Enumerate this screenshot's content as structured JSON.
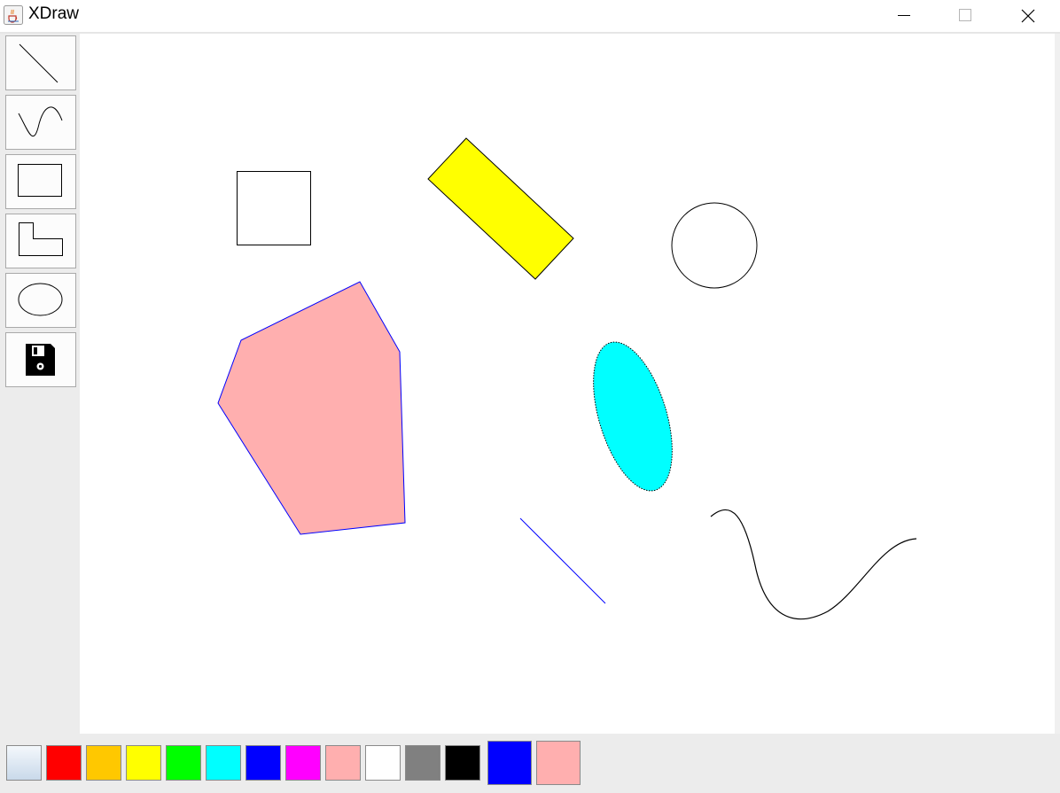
{
  "window": {
    "title": "XDraw",
    "app_icon": "java-coffee-icon",
    "buttons": [
      {
        "name": "minimize-button",
        "icon": "minimize-icon"
      },
      {
        "name": "maximize-button",
        "icon": "maximize-icon"
      },
      {
        "name": "close-button",
        "icon": "close-icon"
      }
    ]
  },
  "toolbar": {
    "tools": [
      {
        "name": "line-tool-button",
        "icon": "line-icon"
      },
      {
        "name": "curve-tool-button",
        "icon": "curve-icon"
      },
      {
        "name": "rectangle-tool-button",
        "icon": "rectangle-icon"
      },
      {
        "name": "polygon-tool-button",
        "icon": "polygon-icon"
      },
      {
        "name": "ellipse-tool-button",
        "icon": "ellipse-icon"
      },
      {
        "name": "save-button",
        "icon": "floppy-disk-icon"
      }
    ]
  },
  "canvas": {
    "shapes": [
      {
        "name": "rectangle-shape",
        "type": "rectangle",
        "fill": "none",
        "stroke": "#000000"
      },
      {
        "name": "rotated-rectangle-shape",
        "type": "polygon",
        "fill": "#ffff00",
        "stroke": "#000000"
      },
      {
        "name": "circle-shape",
        "type": "ellipse",
        "fill": "none",
        "stroke": "#000000"
      },
      {
        "name": "pentagon-shape",
        "type": "polygon",
        "fill": "#ffafaf",
        "stroke": "#0000ff"
      },
      {
        "name": "ellipse-shape",
        "type": "ellipse",
        "fill": "#00ffff",
        "stroke": "#000000"
      },
      {
        "name": "line-shape",
        "type": "line",
        "fill": "none",
        "stroke": "#0000ff"
      },
      {
        "name": "curve-shape",
        "type": "curve",
        "fill": "none",
        "stroke": "#000000"
      }
    ]
  },
  "palette": {
    "colors": [
      {
        "name": "color-swatch-gradient",
        "color": "#dde8f3"
      },
      {
        "name": "color-swatch-red",
        "color": "#ff0000"
      },
      {
        "name": "color-swatch-orange",
        "color": "#ffc800"
      },
      {
        "name": "color-swatch-yellow",
        "color": "#ffff00"
      },
      {
        "name": "color-swatch-green",
        "color": "#00ff00"
      },
      {
        "name": "color-swatch-cyan",
        "color": "#00ffff"
      },
      {
        "name": "color-swatch-blue",
        "color": "#0000ff"
      },
      {
        "name": "color-swatch-magenta",
        "color": "#ff00ff"
      },
      {
        "name": "color-swatch-pink",
        "color": "#ffafaf"
      },
      {
        "name": "color-swatch-white",
        "color": "#ffffff"
      },
      {
        "name": "color-swatch-gray",
        "color": "#808080"
      },
      {
        "name": "color-swatch-black",
        "color": "#000000"
      }
    ],
    "current_stroke_color": "#0000ff",
    "current_fill_color": "#ffafaf"
  }
}
